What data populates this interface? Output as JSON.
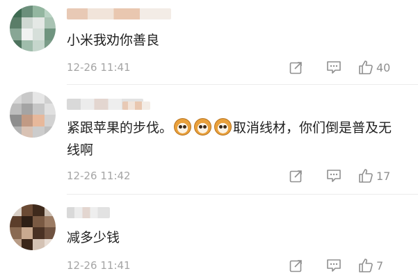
{
  "comments": [
    {
      "text": "小米我劝你善良",
      "time": "12-26 11:41",
      "likes": "40"
    },
    {
      "text_before_emoji": "紧跟苹果的步伐。",
      "emojis": [
        "cat-face-emoji",
        "cat-face-emoji",
        "cat-face-emoji"
      ],
      "text_after_emoji": "取消线材，你们倒是普及无线啊",
      "time": "12-26 11:42",
      "likes": "17"
    },
    {
      "text": "减多少钱",
      "time": "12-26 11:41",
      "likes": "7"
    }
  ],
  "icons": {
    "share": "share-icon",
    "reply": "reply-icon",
    "like": "thumbs-up-icon"
  }
}
